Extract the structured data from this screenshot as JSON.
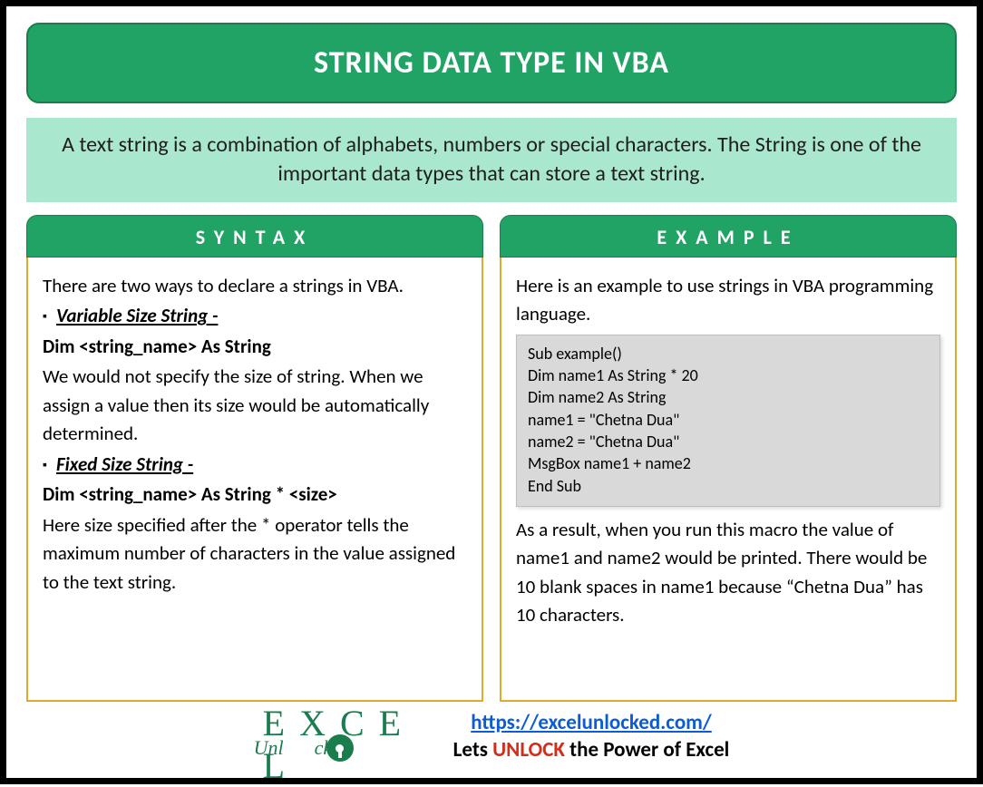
{
  "title": "STRING DATA TYPE IN VBA",
  "intro": "A text string is a combination of alphabets, numbers or special characters. The String is one of the important data types that can store a text string.",
  "syntax": {
    "header": "SYNTAX",
    "lead": "There are two ways to declare a strings in VBA.",
    "item1_label": "Variable Size String -",
    "item1_dim": "Dim <string_name> As String",
    "item1_desc": "We would not specify the size of string. When we assign a value then its size would be automatically determined.",
    "item2_label": "Fixed Size String -",
    "item2_dim": "Dim <string_name> As String * <size>",
    "item2_desc": "Here size specified after the * operator tells the maximum number of characters in the value assigned to the text string."
  },
  "example": {
    "header": "EXAMPLE",
    "lead": "Here is an example to use strings in VBA programming language.",
    "code": "Sub example()\nDim name1 As String * 20\nDim name2 As String\nname1 = \"Chetna Dua\"\nname2 = \"Chetna Dua\"\nMsgBox name1 + name2\nEnd Sub",
    "result": "As a result, when you run this macro the value of name1 and name2 would be printed. There would be 10 blank spaces in name1 because “Chetna Dua” has 10 characters."
  },
  "footer": {
    "logo_main": "E X C E L",
    "logo_sub_left": "Unl",
    "logo_sub_right": "cked",
    "url": "https://excelunlocked.com/",
    "tagline_prefix": "Lets ",
    "tagline_highlight": "UNLOCK",
    "tagline_suffix": " the Power of Excel"
  }
}
